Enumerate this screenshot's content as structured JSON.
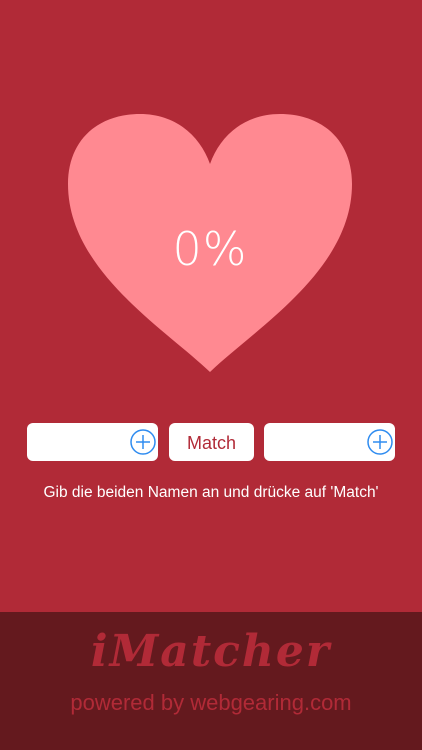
{
  "colors": {
    "background": "#b12a37",
    "heart": "#ff8991",
    "footer": "#64191e",
    "accent_blue": "#2f8cf0",
    "text_light": "#ffffff"
  },
  "heart": {
    "percentage": "0%"
  },
  "inputs": {
    "first_name": {
      "value": "",
      "placeholder": ""
    },
    "second_name": {
      "value": "",
      "placeholder": ""
    },
    "add_icon": "plus-circle-icon"
  },
  "match_button": {
    "label": "Match"
  },
  "instruction": "Gib die beiden Namen an und drücke auf 'Match'",
  "footer": {
    "app_name": "iMatcher",
    "powered_by": "powered by webgearing.com"
  }
}
